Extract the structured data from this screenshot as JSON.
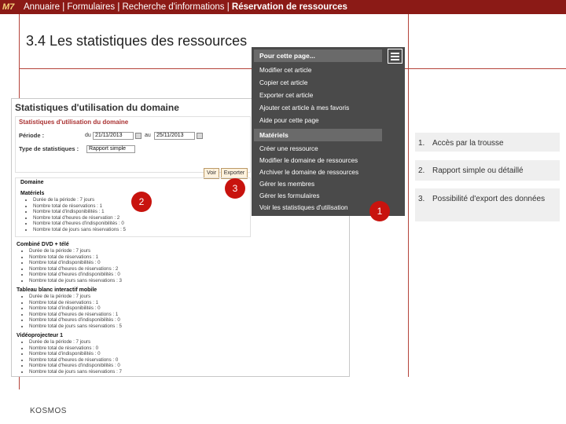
{
  "header": {
    "badge": "M7",
    "crumbs_plain": "Annuaire | Formulaires | Recherche d'informations | ",
    "crumbs_active": "Réservation de ressources"
  },
  "slide_title": "3.4  Les statistiques des ressources",
  "footer": "KOSMOS",
  "screenshot": {
    "heading": "Statistiques d'utilisation du domaine",
    "form_heading": "Statistiques d'utilisation du domaine",
    "period_label": "Période :",
    "from_label": "du",
    "from_value": "21/11/2013",
    "to_label": "au",
    "to_value": "25/11/2013",
    "type_label": "Type de statistiques :",
    "type_value": "Rapport simple",
    "view_button": "Voir",
    "export_button": "Exporter",
    "domain_label": "Domaine",
    "sections": [
      {
        "title": "Matériels",
        "lines": [
          "Durée de la période : 7 jours",
          "Nombre total de réservations : 1",
          "Nombre total d'indisponibilités : 1",
          "Nombre total d'heures de réservation : 2",
          "Nombre total d'heures d'indisponibilités : 0",
          "Nombre total de jours sans réservations : 5"
        ]
      },
      {
        "title": "Combiné DVD + télé",
        "lines": [
          "Durée de la période : 7 jours",
          "Nombre total de réservations : 1",
          "Nombre total d'indisponibilités : 0",
          "Nombre total d'heures de réservations : 2",
          "Nombre total d'heures d'indisponibilités : 0",
          "Nombre total de jours sans réservations : 3"
        ]
      },
      {
        "title": "Tableau blanc interactif mobile",
        "lines": [
          "Durée de la période : 7 jours",
          "Nombre total de réservations : 1",
          "Nombre total d'indisponibilités : 0",
          "Nombre total d'heures de réservations : 1",
          "Nombre total d'heures d'indisponibilités : 0",
          "Nombre total de jours sans réservations : 5"
        ]
      },
      {
        "title": "Vidéoprojecteur 1",
        "lines": [
          "Durée de la période : 7 jours",
          "Nombre total de réservations : 0",
          "Nombre total d'indisponibilités : 0",
          "Nombre total d'heures de réservations : 0",
          "Nombre total d'heures d'indisponibilités : 0",
          "Nombre total de jours sans réservations : 7"
        ]
      }
    ]
  },
  "menu": {
    "head1": "Pour cette page...",
    "items1": [
      "Modifier cet article",
      "Copier cet article",
      "Exporter cet article",
      "Ajouter cet article à mes favoris",
      "Aide pour cette page"
    ],
    "head2": "Matériels",
    "items2": [
      "Créer une ressource",
      "Modifier le domaine de ressources",
      "Archiver le domaine de ressources",
      "Gérer les membres",
      "Gérer les formulaires",
      "Voir les statistiques d'utilisation"
    ]
  },
  "markers": [
    "1",
    "2",
    "3"
  ],
  "notes": [
    {
      "num": "1.",
      "text": "Accès par la trousse"
    },
    {
      "num": "2.",
      "text": "Rapport simple ou détaillé"
    },
    {
      "num": "3.",
      "text": "Possibilité d'export des données"
    }
  ],
  "colors": {
    "brand": "#8b1a16",
    "accent_line": "#b5433a",
    "marker": "#c8130e",
    "menu_bg": "#4a4a4a"
  }
}
